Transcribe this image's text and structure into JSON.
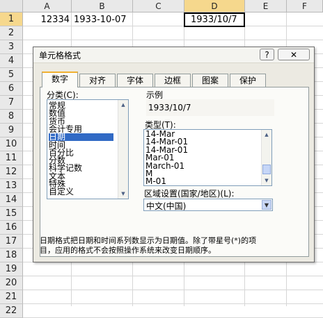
{
  "sheet": {
    "columns": [
      "A",
      "B",
      "C",
      "D",
      "E",
      "F"
    ],
    "rows": [
      "1",
      "2",
      "3",
      "4",
      "5",
      "6",
      "7",
      "8",
      "9",
      "10",
      "11",
      "12",
      "13",
      "14",
      "15",
      "16",
      "17",
      "18",
      "19",
      "20",
      "21",
      "22"
    ],
    "cells": {
      "A1": "12334",
      "B1": "1933-10-07",
      "D1": "1933/10/7"
    }
  },
  "dialog": {
    "title": "单元格格式",
    "help_label": "?",
    "close_label": "✕",
    "tabs": [
      "数字",
      "对齐",
      "字体",
      "边框",
      "图案",
      "保护"
    ],
    "category_label": "分类(C):",
    "categories": [
      "常规",
      "数值",
      "货币",
      "会计专用",
      "日期",
      "时间",
      "百分比",
      "分数",
      "科学记数",
      "文本",
      "特殊",
      "自定义"
    ],
    "selected_category": "日期",
    "sample_label": "示例",
    "sample_value": "1933/10/7",
    "type_label": "类型(T):",
    "types": [
      "14-Mar",
      "14-Mar-01",
      "14-Mar-01",
      "Mar-01",
      "March-01",
      "M",
      "M-01"
    ],
    "locale_label": "区域设置(国家/地区)(L):",
    "locale_value": "中文(中国)",
    "description": "日期格式把日期和时间系列数显示为日期值。除了带星号(*)的项目，应用的格式不会按照操作系统来改变日期顺序。",
    "description_line1": "日期格式把日期和时间系列数显示为日期值。除了带星号(*)的项",
    "description_line2": "目，应用的格式不会按照操作系统来改变日期顺序。"
  }
}
